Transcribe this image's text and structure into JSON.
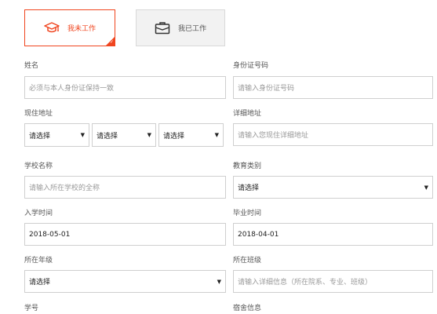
{
  "tabs": {
    "student": {
      "label": "我未工作",
      "selected": true
    },
    "working": {
      "label": "我已工作",
      "selected": false
    }
  },
  "form": {
    "name": {
      "label": "姓名",
      "placeholder": "必须与本人身份证保持一致"
    },
    "id_number": {
      "label": "身份证号码",
      "placeholder": "请输入身份证号码"
    },
    "current_address": {
      "label": "现住地址",
      "province": "请选择",
      "city": "请选择",
      "district": "请选择"
    },
    "detail_address": {
      "label": "详细地址",
      "placeholder": "请输入您现住详细地址"
    },
    "school_name": {
      "label": "学校名称",
      "placeholder": "请输入所在学校的全称"
    },
    "education_type": {
      "label": "教育类别",
      "value": "请选择"
    },
    "enroll_date": {
      "label": "入学时间",
      "value": "2018-05-01"
    },
    "graduation_date": {
      "label": "毕业时间",
      "value": "2018-04-01"
    },
    "grade": {
      "label": "所在年级",
      "value": "请选择"
    },
    "class": {
      "label": "所在班级",
      "placeholder": "请输入详细信息（所在院系、专业、班级）"
    },
    "student_id": {
      "label": "学号"
    },
    "dorm": {
      "label": "宿舍信息"
    }
  },
  "colors": {
    "accent": "#f0451f",
    "border": "#cfcfcf",
    "tab_inactive_bg": "#f2f2f2"
  },
  "icons": {
    "student_tab": "graduation-cap-icon",
    "working_tab": "briefcase-icon",
    "dropdown": "triangle-down-icon",
    "selected_check": "check-icon"
  }
}
